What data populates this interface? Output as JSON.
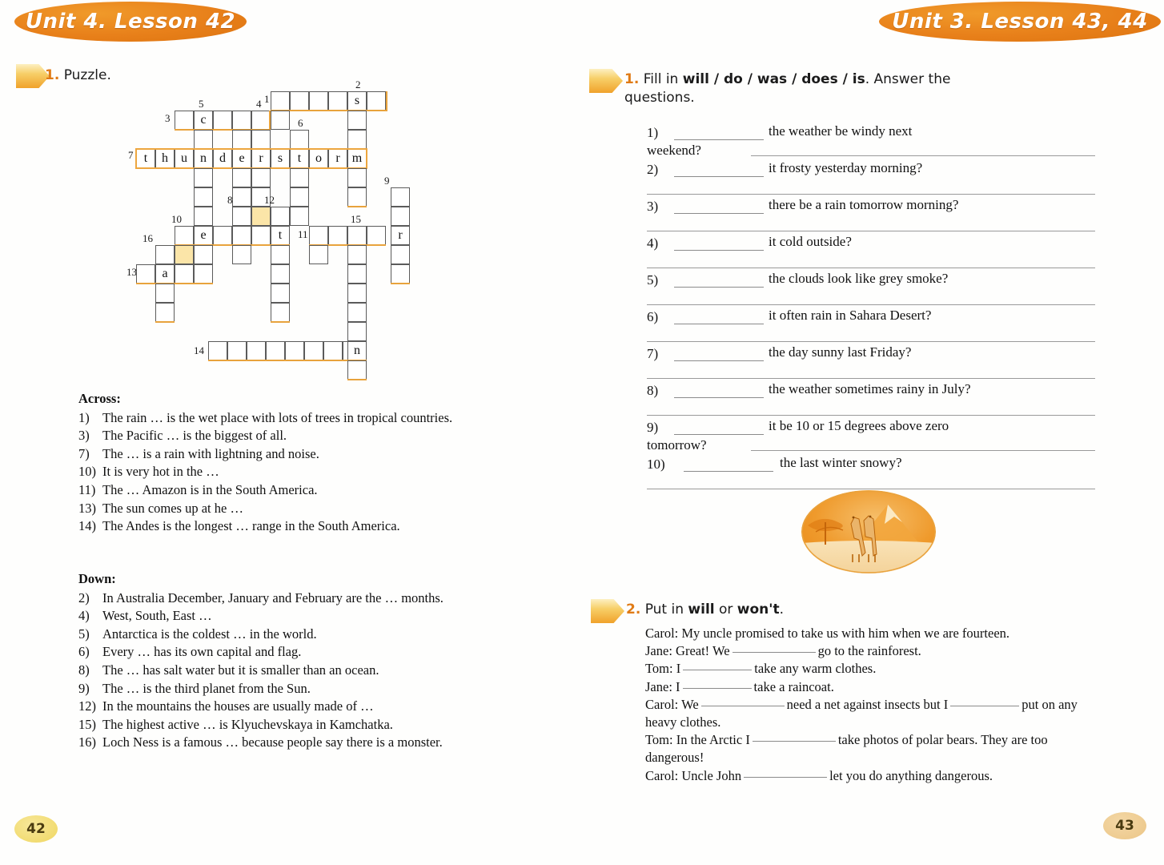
{
  "left_page": {
    "banner": "Unit 4. Lesson 42",
    "page_number": "42",
    "exercise": {
      "number": "1.",
      "title": "Puzzle."
    },
    "crossword": {
      "filled_letters": {
        "thunderstorm": "t h u n d e r s t o r m",
        "c1": "s",
        "c2": "c",
        "c3": "e",
        "c4": "t",
        "c5": "r",
        "c6": "a",
        "c7": "n"
      },
      "across_header": "Across:",
      "across": [
        {
          "n": "1)",
          "text": "The rain … is the wet place with lots of trees in tropical countries."
        },
        {
          "n": "3)",
          "text": "The Pacific … is the biggest of all."
        },
        {
          "n": "7)",
          "text": "The … is a rain with lightning and noise."
        },
        {
          "n": "10)",
          "text": "It is very hot in the …"
        },
        {
          "n": "11)",
          "text": "The … Amazon is in the South America."
        },
        {
          "n": "13)",
          "text": "The sun comes up at he …"
        },
        {
          "n": "14)",
          "text": "The Andes is the longest … range in the South America."
        }
      ],
      "down_header": "Down:",
      "down": [
        {
          "n": "2)",
          "text": "In Australia December, January and February are the … months."
        },
        {
          "n": "4)",
          "text": "West, South, East …"
        },
        {
          "n": "5)",
          "text": "Antarctica is the coldest … in the world."
        },
        {
          "n": "6)",
          "text": "Every … has its own capital and flag."
        },
        {
          "n": "8)",
          "text": "The … has salt water but it is smaller than an ocean."
        },
        {
          "n": "9)",
          "text": "The … is the third planet from the Sun."
        },
        {
          "n": "12)",
          "text": "In the mountains the houses are usually made of …"
        },
        {
          "n": "15)",
          "text": "The highest active … is Klyuchevskaya in Kamchatka."
        },
        {
          "n": "16)",
          "text": "Loch Ness is a famous … because people say there is a monster."
        }
      ]
    }
  },
  "right_page": {
    "banner": "Unit 3. Lesson 43, 44",
    "page_number": "43",
    "exercise1": {
      "number": "1.",
      "title_a": "Fill in ",
      "title_b": "will / do / was / does / is",
      "title_c": ". Answer the",
      "title_d": "questions.",
      "questions": [
        {
          "n": "1)",
          "text": "the weather be windy next",
          "wrap": "weekend?"
        },
        {
          "n": "2)",
          "text": "it frosty yesterday morning?",
          "wrap": ""
        },
        {
          "n": "3)",
          "text": "there be a rain tomorrow morning?",
          "wrap": ""
        },
        {
          "n": "4)",
          "text": "it cold outside?",
          "wrap": ""
        },
        {
          "n": "5)",
          "text": "the clouds look like grey smoke?",
          "wrap": ""
        },
        {
          "n": "6)",
          "text": "it often rain in Sahara Desert?",
          "wrap": ""
        },
        {
          "n": "7)",
          "text": "the day sunny last Friday?",
          "wrap": ""
        },
        {
          "n": "8)",
          "text": "the weather sometimes rainy in July?",
          "wrap": ""
        },
        {
          "n": "9)",
          "text": "it be 10 or 15 degrees above zero",
          "wrap": "tomorrow?"
        },
        {
          "n": "10)",
          "text": "the last winter snowy?",
          "wrap": ""
        }
      ]
    },
    "illustration": "giraffes-savanna-oval-picture",
    "exercise2": {
      "number": "2.",
      "title_a": "Put in ",
      "title_b": "will",
      "title_c": " or ",
      "title_d": "won't",
      "title_e": ".",
      "lines": [
        {
          "speaker": "Carol:",
          "p1": "My uncle promised to take us with him when we are fourteen.",
          "blank": false,
          "p2": ""
        },
        {
          "speaker": "Jane:",
          "p1": "Great! We",
          "blank": true,
          "p2": "go to the rainforest."
        },
        {
          "speaker": "Tom:",
          "p1": "I",
          "blank": true,
          "p2": "take any warm clothes."
        },
        {
          "speaker": "Jane:",
          "p1": "I",
          "blank": true,
          "p2": "take a raincoat."
        },
        {
          "speaker": "Carol:",
          "p1": "We",
          "blank": true,
          "p2": "need a net against insects but I",
          "blank2": true,
          "p3": "put on any heavy clothes."
        },
        {
          "speaker": "Tom:",
          "p1": "In the Arctic I",
          "blank": true,
          "p2": "take photos of polar bears. They are too dangerous!"
        },
        {
          "speaker": "Carol:",
          "p1": "Uncle John",
          "blank": true,
          "p2": "let you do anything dangerous."
        }
      ]
    }
  },
  "colors": {
    "banner_orange": "#e8801a",
    "accent_orange": "#e8a33d",
    "highlight_yellow": "#fbe5a8",
    "pageno_yellow": "#f2dc72",
    "pageno_tan": "#eecb90",
    "grid_line": "#5b5b5b",
    "rule_gray": "#8b8b8b"
  }
}
